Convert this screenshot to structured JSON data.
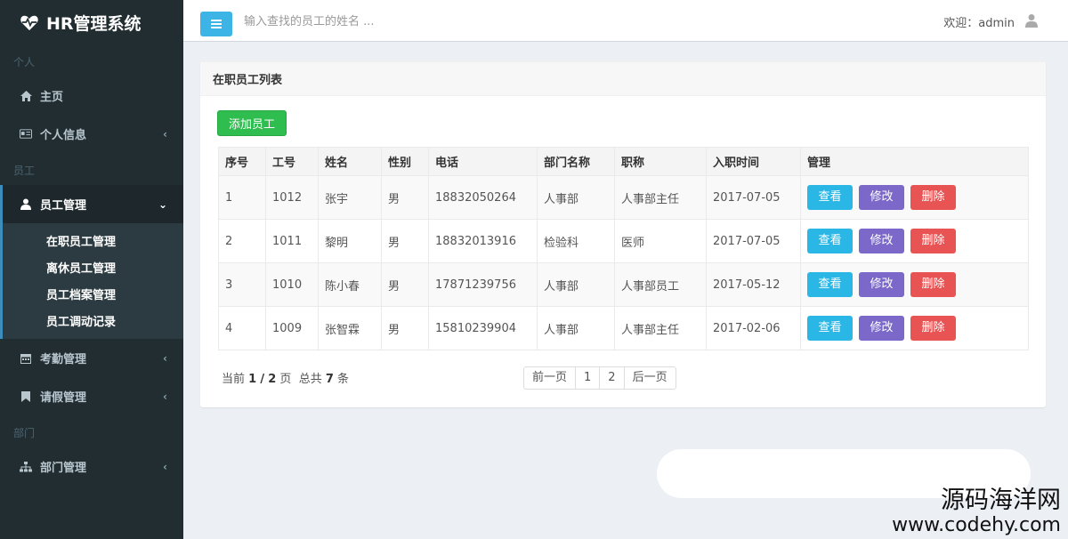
{
  "app": {
    "title": "HR管理系统"
  },
  "sidebar": {
    "sections": {
      "personal": "个人",
      "staff": "员工",
      "dept": "部门"
    },
    "items": {
      "home": "主页",
      "profile": "个人信息",
      "employee": "员工管理",
      "attendance": "考勤管理",
      "leave": "请假管理",
      "department": "部门管理"
    },
    "submenu": [
      "在职员工管理",
      "离休员工管理",
      "员工档案管理",
      "员工调动记录"
    ]
  },
  "header": {
    "search_placeholder": "输入查找的员工的姓名 ...",
    "welcome": "欢迎：admin"
  },
  "main": {
    "box_title": "在职员工列表",
    "add_button": "添加员工",
    "columns": [
      "序号",
      "工号",
      "姓名",
      "性别",
      "电话",
      "部门名称",
      "职称",
      "入职时间",
      "管理"
    ],
    "rows": [
      [
        "1",
        "1012",
        "张宇",
        "男",
        "18832050264",
        "人事部",
        "人事部主任",
        "2017-07-05"
      ],
      [
        "2",
        "1011",
        "黎明",
        "男",
        "18832013916",
        "检验科",
        "医师",
        "2017-07-05"
      ],
      [
        "3",
        "1010",
        "陈小春",
        "男",
        "17871239756",
        "人事部",
        "人事部员工",
        "2017-05-12"
      ],
      [
        "4",
        "1009",
        "张智霖",
        "男",
        "15810239904",
        "人事部",
        "人事部主任",
        "2017-02-06"
      ]
    ],
    "actions": {
      "view": "查看",
      "edit": "修改",
      "delete": "删除"
    },
    "pagination": {
      "prefix": "当前",
      "current": "1",
      "sep": "/",
      "total_pages": "2",
      "page_word": "页",
      "total_prefix": "总共",
      "total_count": "7",
      "count_word": "条",
      "prev": "前一页",
      "pages": [
        "1",
        "2"
      ],
      "next": "后一页"
    }
  },
  "watermark": {
    "cn": "源码海洋网",
    "url": "www.codehy.com"
  },
  "colors": {
    "sidebar_bg": "#222d32",
    "accent": "#3c8dbc",
    "add_green": "#2fbd4f",
    "view_blue": "#2ab7e6",
    "edit_purple": "#7b68c8",
    "delete_red": "#e85454"
  }
}
